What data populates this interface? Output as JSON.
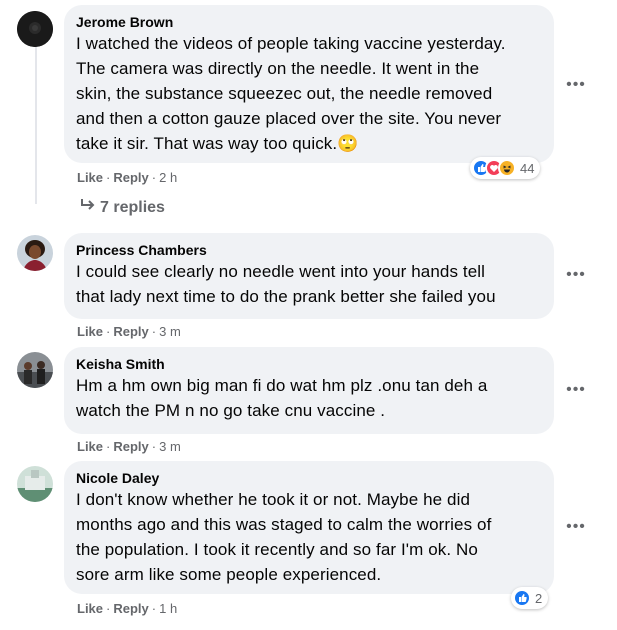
{
  "comments": [
    {
      "author": "Jerome Brown",
      "lines": [
        "I watched the videos of people taking vaccine yesterday.",
        "The camera was directly on the needle. It went in the",
        "skin, the substance squeezec out, the needle removed",
        "and then a cotton gauze placed over the site. You never",
        "take it sir. That was way too quick.🙄"
      ],
      "like": "Like",
      "reply": "Reply",
      "time": "2 h",
      "reaction_count": "44",
      "reaction_icons": [
        "like-icon",
        "love-icon",
        "haha-icon"
      ]
    },
    {
      "author": "Princess Chambers",
      "lines": [
        "I could see clearly no needle went into your hands tell",
        "that lady next time to do the prank better she failed you"
      ],
      "like": "Like",
      "reply": "Reply",
      "time": "3 m"
    },
    {
      "author": "Keisha Smith",
      "lines": [
        "Hm a hm own big man fi do wat hm plz .onu tan deh a",
        "watch the PM n no go take cnu vaccine ."
      ],
      "like": "Like",
      "reply": "Reply",
      "time": "3 m"
    },
    {
      "author": "Nicole Daley",
      "lines": [
        "I don't know whether he took it or not. Maybe he did",
        "months ago and this was staged to calm the worries of",
        "the population. I took it recently and so far I'm ok. No",
        "sore arm like some people experienced."
      ],
      "like": "Like",
      "reply": "Reply",
      "time": "1 h",
      "reaction_count": "2",
      "reaction_icons": [
        "like-icon"
      ]
    }
  ],
  "replies_link": "7 replies",
  "replies_icon": "reply-arrow-icon",
  "more_icon": "more-options-icon",
  "colors": {
    "bubble": "#f0f2f5",
    "secondary_text": "#65676b",
    "like_blue": "#1877f2",
    "love_red": "#f33e58",
    "haha_yellow": "#f7b125"
  }
}
